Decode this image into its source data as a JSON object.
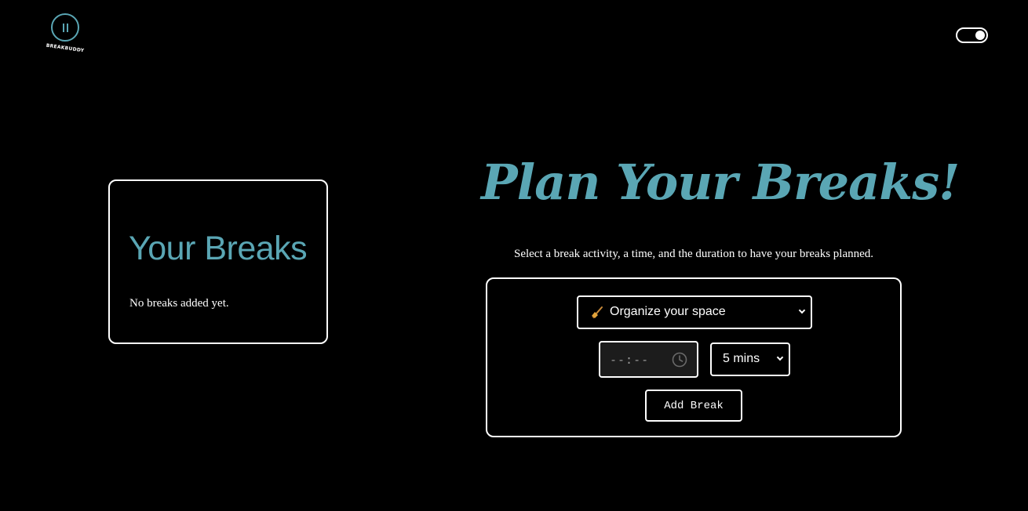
{
  "app": {
    "logo_text": "BREAKBUDDY",
    "accent_color": "#5aa6b4",
    "theme_toggle": {
      "state": "on"
    }
  },
  "breaks_panel": {
    "title": "Your Breaks",
    "empty_message": "No breaks added yet."
  },
  "planner": {
    "title": "Plan Your Breaks!",
    "subtitle": "Select a break activity, a time, and the duration to have your breaks planned.",
    "activity_select": {
      "icon": "broom-icon",
      "selected": "Organize your space"
    },
    "time_input": {
      "placeholder": "--:--",
      "icon": "clock-icon"
    },
    "duration_select": {
      "selected": "5 mins"
    },
    "add_button_label": "Add Break"
  }
}
